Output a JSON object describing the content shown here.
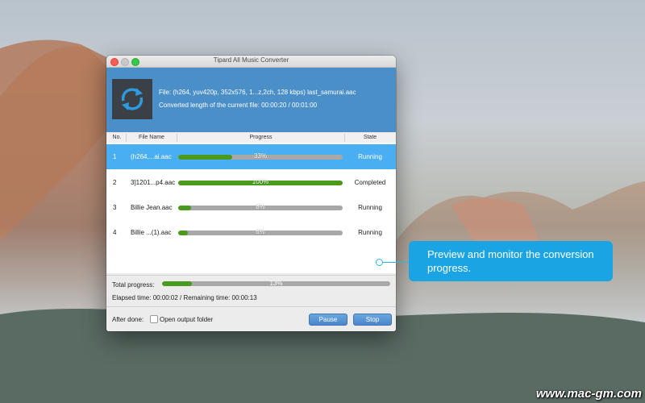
{
  "window": {
    "title": "Tipard All Music Converter"
  },
  "info": {
    "file_line": "File:  (h264, yuv420p, 352x576, 1...z,2ch, 128 kbps)  last_samurai.aac",
    "length_line": "Converted length of the current file: 00:00:20 / 00:01:00",
    "thumbnail_icon": "refresh-icon"
  },
  "table": {
    "headers": {
      "no": "No.",
      "name": "File Name",
      "progress": "Progress",
      "state": "State"
    },
    "rows": [
      {
        "no": "1",
        "name": "(h264,...ai.aac",
        "progress": 0.33,
        "percent": "33%",
        "state": "Running",
        "selected": true
      },
      {
        "no": "2",
        "name": "3]1201...p4.aac",
        "progress": 1.0,
        "percent": "100%",
        "state": "Completed",
        "selected": false
      },
      {
        "no": "3",
        "name": "Billie Jean.aac",
        "progress": 0.08,
        "percent": "8%",
        "state": "Running",
        "selected": false
      },
      {
        "no": "4",
        "name": "Billie ...(1).aac",
        "progress": 0.06,
        "percent": "6%",
        "state": "Running",
        "selected": false
      }
    ]
  },
  "footer": {
    "total_label": "Total progress:",
    "total_progress": 0.13,
    "total_percent": "13%",
    "elapsed": "Elapsed time: 00:00:02 / Remaining time: 00:00:13",
    "after_done_label": "After done:",
    "open_folder_label": "Open output folder",
    "open_folder_checked": false,
    "pause_label": "Pause",
    "stop_label": "Stop"
  },
  "callout": {
    "text": "Preview and monitor the conversion progress."
  },
  "watermark": "www.mac-gm.com",
  "colors": {
    "accent": "#4a8fc8",
    "selected_row": "#4aaef2",
    "progress_fill": "#4a9a1e",
    "callout": "#1ba4e4"
  }
}
